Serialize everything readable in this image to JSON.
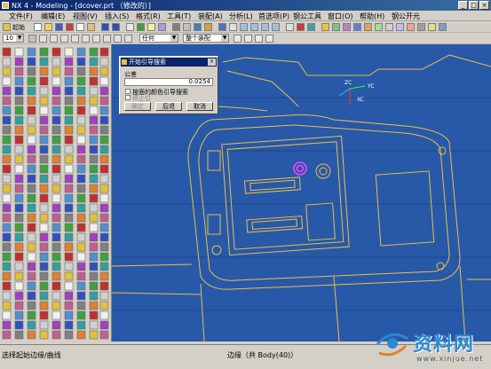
{
  "window": {
    "title": "NX 4 - Modeling - [dcover.prt （修改的）]"
  },
  "menu": [
    "文件(F)",
    "编辑(E)",
    "视图(V)",
    "插入(S)",
    "格式(R)",
    "工具(T)",
    "装配(A)",
    "分析(L)",
    "首选项(P)",
    "钢公工具",
    "窗口(O)",
    "帮助(H)",
    "钢公开元"
  ],
  "toolbar": {
    "start_label": "起始",
    "num_combo": "10",
    "filter_combo": "任何",
    "assembly_combo": "整个装配"
  },
  "dialog": {
    "title": "开始引导搜索",
    "tolerance_label": "公差",
    "tolerance_value": "0.0254",
    "checkbox1_label": "按面的颜色引导搜索",
    "checkbox2_label": "停止位",
    "ok_label": "确定",
    "back_label": "后退",
    "cancel_label": "取消"
  },
  "status": {
    "prompt": "选择起始边缘/曲线",
    "selection": "边缘（共 Body(40)）"
  },
  "watermark": {
    "text": "资料网",
    "url": "www.xinjue.net"
  },
  "viewport": {
    "triad_z": "ZC",
    "triad_y": "YC",
    "triad_x": "XC"
  },
  "colors": {
    "title_bar": "#0a246a",
    "viewport_bg": "#2858a8",
    "wireframe": "#e8c048",
    "highlight": "#ff44ff"
  }
}
